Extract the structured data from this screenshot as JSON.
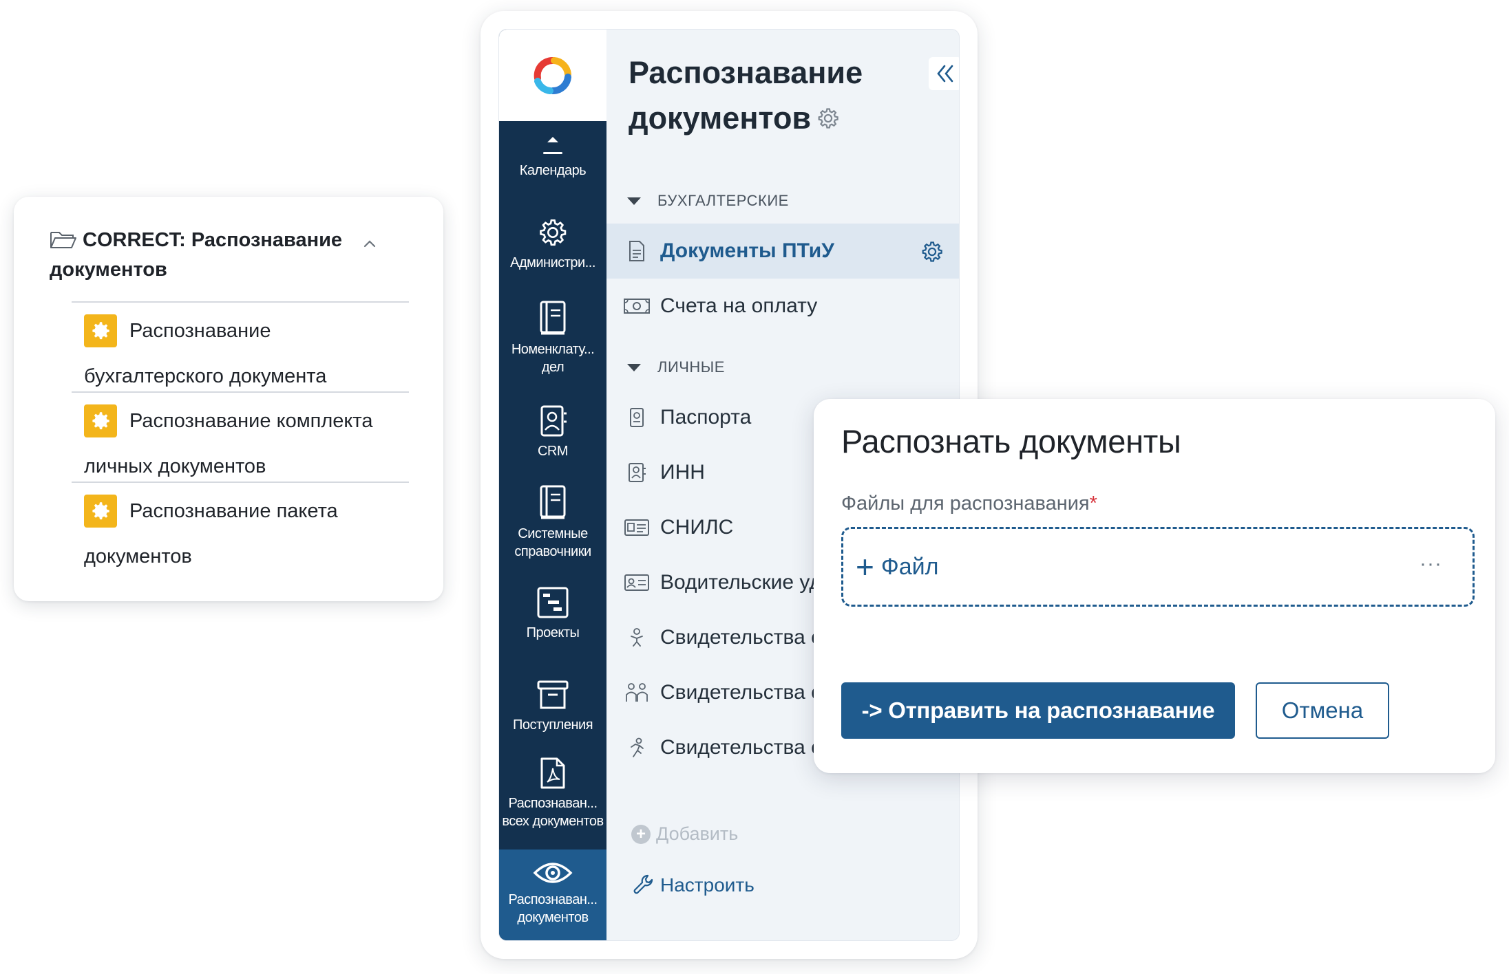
{
  "process_card": {
    "title": "CORRECT: Распознавание документов",
    "items": [
      {
        "line1": "Распознавание",
        "line2": "бухгалтерского документа",
        "icon": "gear-icon"
      },
      {
        "line1": "Распознавание комплекта",
        "line2": "личных документов",
        "icon": "gear-icon"
      },
      {
        "line1": "Распознавание пакета",
        "line2": "документов",
        "icon": "gear-icon"
      }
    ]
  },
  "rail": {
    "items": [
      {
        "label": "Календарь",
        "icon": "calendar-icon"
      },
      {
        "label": "Администри...",
        "icon": "gear-icon"
      },
      {
        "label": "Номенклату... дел",
        "icon": "book-icon"
      },
      {
        "label": "CRM",
        "icon": "contact-icon"
      },
      {
        "label": "Системные справочники",
        "icon": "book-icon"
      },
      {
        "label": "Проекты",
        "icon": "projects-icon"
      },
      {
        "label": "Поступления",
        "icon": "archive-icon"
      },
      {
        "label": "Распознаван... всех документов",
        "icon": "pdf-icon"
      },
      {
        "label": "Распознаван... документов",
        "icon": "eye-icon",
        "active": true
      }
    ]
  },
  "content": {
    "title": "Распознавание документов",
    "groups": [
      {
        "label": "БУХГАЛТЕРСКИЕ",
        "items": [
          {
            "label": "Документы ПТиУ",
            "icon": "document-icon",
            "selected": true
          },
          {
            "label": "Счета на оплату",
            "icon": "banknote-icon"
          }
        ]
      },
      {
        "label": "ЛИЧНЫЕ",
        "items": [
          {
            "label": "Паспорта",
            "icon": "passport-icon"
          },
          {
            "label": "ИНН",
            "icon": "person-card-icon"
          },
          {
            "label": "СНИЛС",
            "icon": "id-card-icon"
          },
          {
            "label": "Водительские уд",
            "icon": "license-icon"
          },
          {
            "label": "Свидетельства о",
            "icon": "baby-icon"
          },
          {
            "label": "Свидетельства о",
            "icon": "couple-icon"
          },
          {
            "label": "Свидетельства о",
            "icon": "runner-icon"
          }
        ]
      }
    ],
    "add_label": "Добавить",
    "setup_label": "Настроить"
  },
  "modal": {
    "title": "Распознать документы",
    "field_label": "Файлы для распознавания",
    "required_mark": "*",
    "add_file_label": "Файл",
    "dots": "···",
    "submit_label": "-> Отправить на распознавание",
    "cancel_label": "Отмена"
  },
  "colors": {
    "accent": "#1f5b8e",
    "rail_bg": "#13314f",
    "gear_badge": "#f3b51b",
    "required": "#d6323a"
  }
}
